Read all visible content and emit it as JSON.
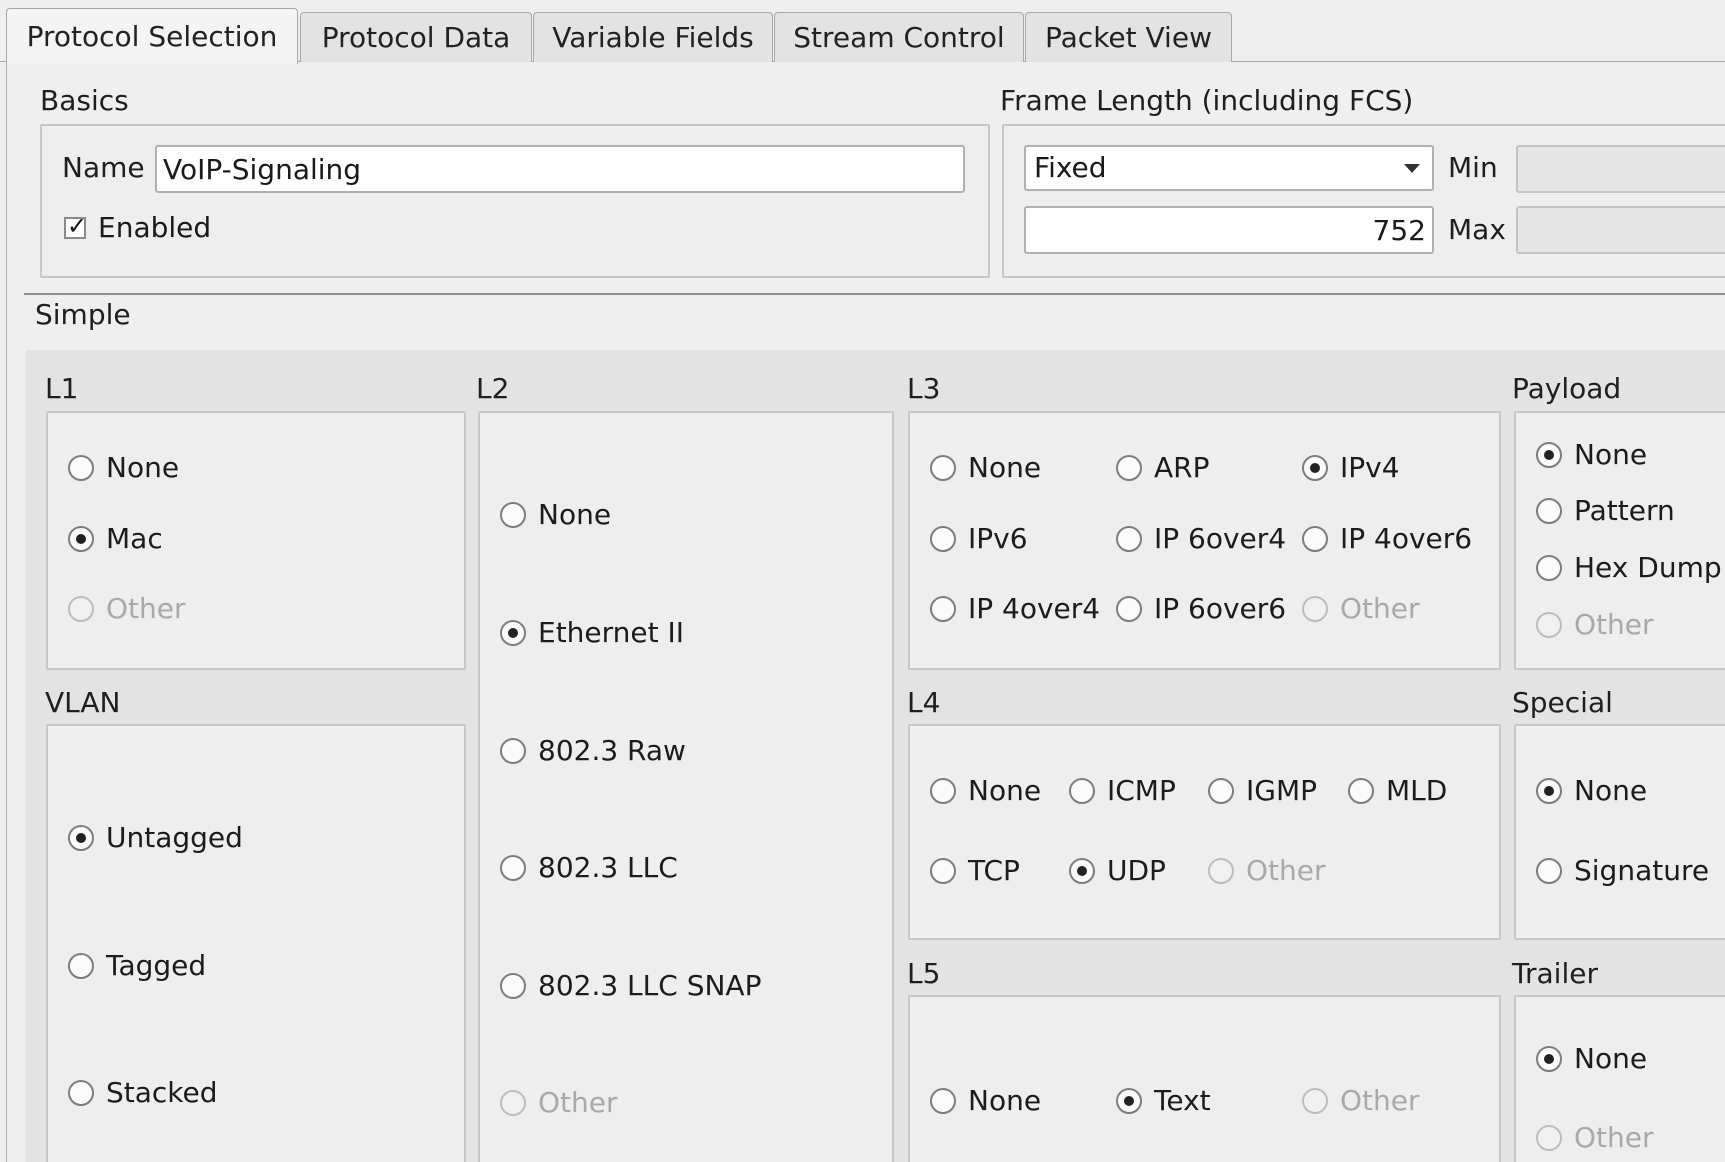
{
  "tabs": [
    {
      "label": "Protocol Selection",
      "active": true
    },
    {
      "label": "Protocol Data",
      "active": false
    },
    {
      "label": "Variable Fields",
      "active": false
    },
    {
      "label": "Stream Control",
      "active": false
    },
    {
      "label": "Packet View",
      "active": false
    }
  ],
  "basics": {
    "title": "Basics",
    "name_label": "Name",
    "name_value": "VoIP-Signaling",
    "enabled_label": "Enabled",
    "enabled": true
  },
  "frame_length": {
    "title": "Frame Length (including FCS)",
    "mode": "Fixed",
    "value": "752",
    "min_label": "Min",
    "max_label": "Max",
    "min_value": "",
    "max_value": ""
  },
  "simple": {
    "title": "Simple",
    "groups": {
      "l1": {
        "title": "L1",
        "options": [
          {
            "label": "None",
            "checked": false,
            "disabled": false
          },
          {
            "label": "Mac",
            "checked": true,
            "disabled": false
          },
          {
            "label": "Other",
            "checked": false,
            "disabled": true
          }
        ]
      },
      "vlan": {
        "title": "VLAN",
        "options": [
          {
            "label": "Untagged",
            "checked": true,
            "disabled": false
          },
          {
            "label": "Tagged",
            "checked": false,
            "disabled": false
          },
          {
            "label": "Stacked",
            "checked": false,
            "disabled": false
          }
        ]
      },
      "l2": {
        "title": "L2",
        "options": [
          {
            "label": "None",
            "checked": false,
            "disabled": false
          },
          {
            "label": "Ethernet II",
            "checked": true,
            "disabled": false
          },
          {
            "label": "802.3 Raw",
            "checked": false,
            "disabled": false
          },
          {
            "label": "802.3 LLC",
            "checked": false,
            "disabled": false
          },
          {
            "label": "802.3 LLC SNAP",
            "checked": false,
            "disabled": false
          },
          {
            "label": "Other",
            "checked": false,
            "disabled": true
          }
        ]
      },
      "l3": {
        "title": "L3",
        "options": [
          {
            "label": "None",
            "checked": false,
            "disabled": false
          },
          {
            "label": "ARP",
            "checked": false,
            "disabled": false
          },
          {
            "label": "IPv4",
            "checked": true,
            "disabled": false
          },
          {
            "label": "IPv6",
            "checked": false,
            "disabled": false
          },
          {
            "label": "IP 6over4",
            "checked": false,
            "disabled": false
          },
          {
            "label": "IP 4over6",
            "checked": false,
            "disabled": false
          },
          {
            "label": "IP 4over4",
            "checked": false,
            "disabled": false
          },
          {
            "label": "IP 6over6",
            "checked": false,
            "disabled": false
          },
          {
            "label": "Other",
            "checked": false,
            "disabled": true
          }
        ]
      },
      "l4": {
        "title": "L4",
        "options": [
          {
            "label": "None",
            "checked": false,
            "disabled": false
          },
          {
            "label": "ICMP",
            "checked": false,
            "disabled": false
          },
          {
            "label": "IGMP",
            "checked": false,
            "disabled": false
          },
          {
            "label": "MLD",
            "checked": false,
            "disabled": false
          },
          {
            "label": "TCP",
            "checked": false,
            "disabled": false
          },
          {
            "label": "UDP",
            "checked": true,
            "disabled": false
          },
          {
            "label": "Other",
            "checked": false,
            "disabled": true
          }
        ]
      },
      "l5": {
        "title": "L5",
        "options": [
          {
            "label": "None",
            "checked": false,
            "disabled": false
          },
          {
            "label": "Text",
            "checked": true,
            "disabled": false
          },
          {
            "label": "Other",
            "checked": false,
            "disabled": true
          }
        ]
      },
      "payload": {
        "title": "Payload",
        "options": [
          {
            "label": "None",
            "checked": true,
            "disabled": false
          },
          {
            "label": "Pattern",
            "checked": false,
            "disabled": false
          },
          {
            "label": "Hex Dump",
            "checked": false,
            "disabled": false
          },
          {
            "label": "Other",
            "checked": false,
            "disabled": true
          }
        ]
      },
      "special": {
        "title": "Special",
        "options": [
          {
            "label": "None",
            "checked": true,
            "disabled": false
          },
          {
            "label": "Signature",
            "checked": false,
            "disabled": false
          }
        ]
      },
      "trailer": {
        "title": "Trailer",
        "options": [
          {
            "label": "None",
            "checked": true,
            "disabled": false
          },
          {
            "label": "Other",
            "checked": false,
            "disabled": true
          }
        ]
      }
    }
  }
}
